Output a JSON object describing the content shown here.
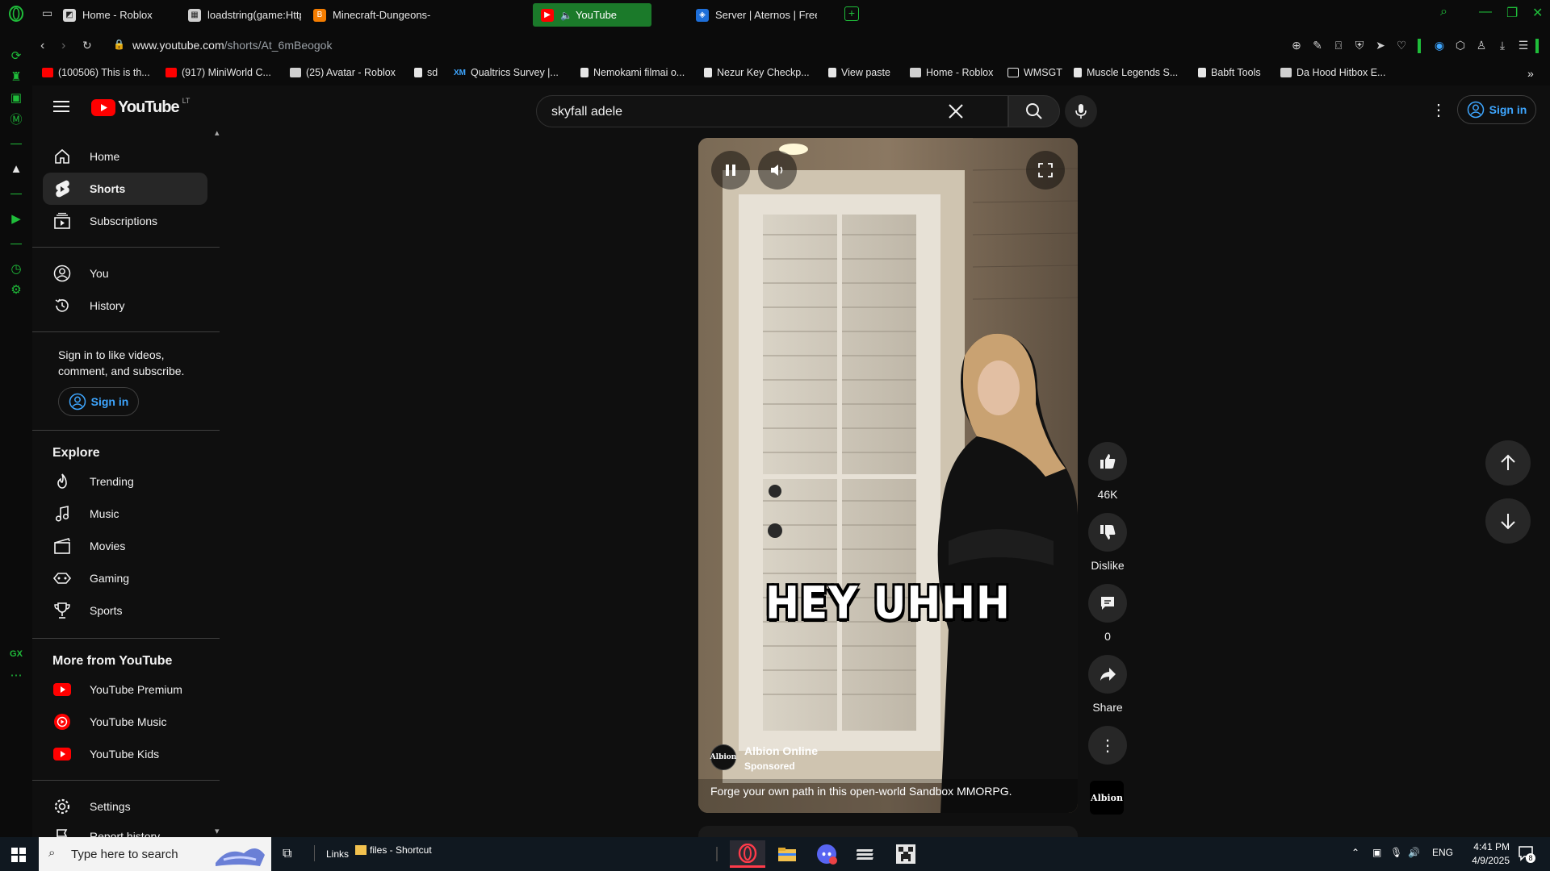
{
  "tabs": [
    {
      "label": "Home - Roblox",
      "favicon": "roblox-icon",
      "active": false
    },
    {
      "label": "loadstring(game:HttpGet(",
      "favicon": "pastebin-icon",
      "active": false
    },
    {
      "label": "Minecraft-Dungeons-Ste",
      "favicon": "blogger-icon",
      "active": false
    },
    {
      "label": "YouTube",
      "favicon": "youtube-icon",
      "active": true
    },
    {
      "label": "Server | Aternos | Free M",
      "favicon": "aternos-icon",
      "active": false
    }
  ],
  "address": {
    "domain": "www.youtube.com",
    "path": "/shorts/At_6mBeogok"
  },
  "bookmarks": [
    {
      "label": "(100506) This is th...",
      "icon": "youtube-icon"
    },
    {
      "label": "(917) MiniWorld C...",
      "icon": "youtube-icon"
    },
    {
      "label": "(25) Avatar - Roblox",
      "icon": "roblox-icon"
    },
    {
      "label": "sd",
      "icon": "page-icon"
    },
    {
      "label": "Qualtrics Survey |...",
      "icon": "qualtrics-icon"
    },
    {
      "label": "Nemokami filmai o...",
      "icon": "page-icon"
    },
    {
      "label": "Nezur Key Checkp...",
      "icon": "page-icon"
    },
    {
      "label": "View paste",
      "icon": "page-icon"
    },
    {
      "label": "Home - Roblox",
      "icon": "roblox-icon"
    },
    {
      "label": "WMSGT",
      "icon": "folder-icon"
    },
    {
      "label": "Muscle Legends S...",
      "icon": "page-icon"
    },
    {
      "label": "Babft Tools",
      "icon": "page-icon"
    },
    {
      "label": "Da Hood Hitbox E...",
      "icon": "page-icon"
    }
  ],
  "youtube": {
    "logo_text": "YouTube",
    "country_code": "LT",
    "search_value": "skyfall adele",
    "sign_in": "Sign in"
  },
  "guide": {
    "main": [
      {
        "label": "Home",
        "icon": "home-icon"
      },
      {
        "label": "Shorts",
        "icon": "shorts-icon",
        "active": true
      },
      {
        "label": "Subscriptions",
        "icon": "subscriptions-icon"
      }
    ],
    "you": [
      {
        "label": "You",
        "icon": "you-icon"
      },
      {
        "label": "History",
        "icon": "history-icon"
      }
    ],
    "signin_prompt": "Sign in to like videos, comment, and subscribe.",
    "signin_button": "Sign in",
    "explore_title": "Explore",
    "explore": [
      {
        "label": "Trending",
        "icon": "trending-icon"
      },
      {
        "label": "Music",
        "icon": "music-icon"
      },
      {
        "label": "Movies",
        "icon": "movies-icon"
      },
      {
        "label": "Gaming",
        "icon": "gaming-icon"
      },
      {
        "label": "Sports",
        "icon": "sports-icon"
      }
    ],
    "more_title": "More from YouTube",
    "more": [
      {
        "label": "YouTube Premium",
        "icon": "youtube-premium-icon"
      },
      {
        "label": "YouTube Music",
        "icon": "youtube-music-icon"
      },
      {
        "label": "YouTube Kids",
        "icon": "youtube-kids-icon"
      }
    ],
    "settings": "Settings",
    "report_history": "Report history"
  },
  "short": {
    "caption_overlay": "HEY UHHH",
    "channel": "Albion Online",
    "sponsored": "Sponsored",
    "description": "Forge your own path in this open-world Sandbox MMORPG.",
    "channel_logo_text": "Albion",
    "likes": "46K",
    "dislike": "Dislike",
    "comments": "0",
    "share": "Share"
  },
  "taskbar": {
    "search_placeholder": "Type here to search",
    "links": "Links",
    "files_shortcut": "files - Shortcut",
    "language": "ENG",
    "time": "4:41 PM",
    "date": "4/9/2025",
    "notifications": "8"
  },
  "colors": {
    "accent_gx": "#1fbd3a",
    "youtube_red": "#ff0000",
    "link_blue": "#3ea6ff"
  }
}
